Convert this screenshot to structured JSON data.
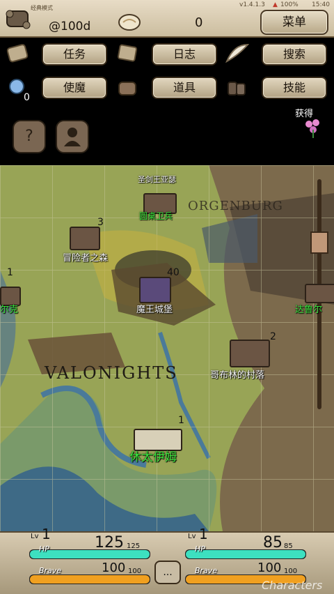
{
  "top": {
    "version": "v1.4.1.3",
    "battery": "100%",
    "clock": "15:40",
    "mode": "经典模式",
    "money": "@100d",
    "gems": "0",
    "menu_label": "菜单"
  },
  "panel": {
    "row1": [
      "任务",
      "日志",
      "搜索"
    ],
    "row2": [
      "使魔",
      "道具",
      "技能"
    ],
    "familiar_count": "0",
    "reward_label": "获得",
    "help_label": "?"
  },
  "map": {
    "region_north": "ORGENBURG",
    "region_south": "VALONIGHTS",
    "locations": [
      {
        "name": "圣剑王亚瑟",
        "count": ""
      },
      {
        "name": "圆桌卫兵",
        "count": ""
      },
      {
        "name": "冒险者之森",
        "count": "3"
      },
      {
        "name": "魔王城堡",
        "count": "40"
      },
      {
        "name": "尔克",
        "count": "1"
      },
      {
        "name": "达鲁尔",
        "count": ""
      },
      {
        "name": "哥布林的村落",
        "count": "2"
      },
      {
        "name": "休太伊姆",
        "count": "1"
      }
    ]
  },
  "party": [
    {
      "level_prefix": "Lv",
      "level": "1",
      "hp_label": "HP",
      "hp": "125",
      "hp_max": "125",
      "brave_label": "Brave",
      "brave": "100",
      "brave_max": "100",
      "hp_fill": 1.0,
      "brave_fill": 1.0
    },
    {
      "level_prefix": "Lv",
      "level": "1",
      "hp_label": "HP",
      "hp": "85",
      "hp_max": "85",
      "brave_label": "Brave",
      "brave": "100",
      "brave_max": "100",
      "hp_fill": 1.0,
      "brave_fill": 1.0
    }
  ],
  "bottom": {
    "more_label": "...",
    "watermark": "Characters"
  },
  "colors": {
    "hp": "#3de0c0",
    "brave": "#f0a020",
    "green_label": "#38e23b"
  }
}
